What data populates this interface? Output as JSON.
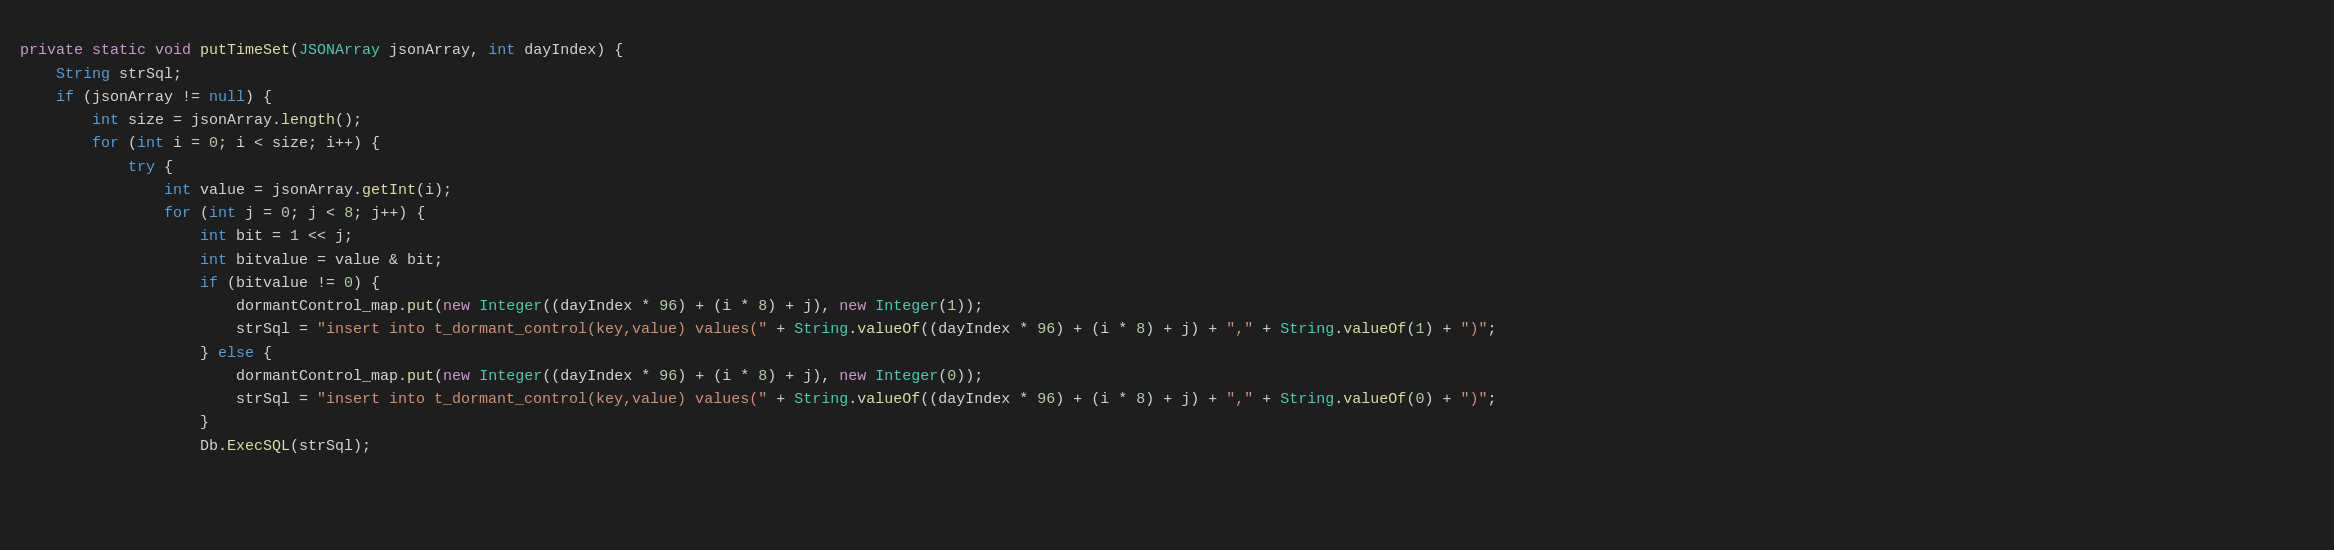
{
  "code": {
    "lines": [
      {
        "id": 1,
        "tokens": [
          {
            "text": "private ",
            "cls": "kw-purple"
          },
          {
            "text": "static ",
            "cls": "kw-purple"
          },
          {
            "text": "void ",
            "cls": "kw-purple"
          },
          {
            "text": "putTimeSet",
            "cls": "fn-yellow"
          },
          {
            "text": "(",
            "cls": "plain"
          },
          {
            "text": "JSONArray",
            "cls": "type-teal"
          },
          {
            "text": " jsonArray, ",
            "cls": "plain"
          },
          {
            "text": "int",
            "cls": "kw-blue"
          },
          {
            "text": " dayIndex) ",
            "cls": "plain"
          },
          {
            "text": "{",
            "cls": "plain"
          }
        ]
      },
      {
        "id": 2,
        "tokens": [
          {
            "text": "    ",
            "cls": "plain"
          },
          {
            "text": "String",
            "cls": "kw-blue"
          },
          {
            "text": " strSql;",
            "cls": "plain"
          }
        ]
      },
      {
        "id": 3,
        "tokens": [
          {
            "text": "    ",
            "cls": "plain"
          },
          {
            "text": "if",
            "cls": "kw-blue"
          },
          {
            "text": " (jsonArray != ",
            "cls": "plain"
          },
          {
            "text": "null",
            "cls": "null-blue"
          },
          {
            "text": ") {",
            "cls": "plain"
          }
        ]
      },
      {
        "id": 4,
        "tokens": [
          {
            "text": "        ",
            "cls": "plain"
          },
          {
            "text": "int",
            "cls": "kw-blue"
          },
          {
            "text": " size = jsonArray.",
            "cls": "plain"
          },
          {
            "text": "length",
            "cls": "fn-yellow"
          },
          {
            "text": "();",
            "cls": "plain"
          }
        ]
      },
      {
        "id": 5,
        "tokens": [
          {
            "text": "        ",
            "cls": "plain"
          },
          {
            "text": "for",
            "cls": "kw-blue"
          },
          {
            "text": " (",
            "cls": "plain"
          },
          {
            "text": "int",
            "cls": "kw-blue"
          },
          {
            "text": " i = ",
            "cls": "plain"
          },
          {
            "text": "0",
            "cls": "num-green"
          },
          {
            "text": "; i < size; i++) {",
            "cls": "plain"
          }
        ]
      },
      {
        "id": 6,
        "tokens": [
          {
            "text": "            ",
            "cls": "plain"
          },
          {
            "text": "try",
            "cls": "kw-blue"
          },
          {
            "text": " {",
            "cls": "plain"
          }
        ]
      },
      {
        "id": 7,
        "tokens": [
          {
            "text": "                ",
            "cls": "plain"
          },
          {
            "text": "int",
            "cls": "kw-blue"
          },
          {
            "text": " value = jsonArray.",
            "cls": "plain"
          },
          {
            "text": "getInt",
            "cls": "fn-yellow"
          },
          {
            "text": "(i);",
            "cls": "plain"
          }
        ]
      },
      {
        "id": 8,
        "tokens": [
          {
            "text": "                ",
            "cls": "plain"
          },
          {
            "text": "for",
            "cls": "kw-blue"
          },
          {
            "text": " (",
            "cls": "plain"
          },
          {
            "text": "int",
            "cls": "kw-blue"
          },
          {
            "text": " j = ",
            "cls": "plain"
          },
          {
            "text": "0",
            "cls": "num-green"
          },
          {
            "text": "; j < ",
            "cls": "plain"
          },
          {
            "text": "8",
            "cls": "num-green"
          },
          {
            "text": "; j++) {",
            "cls": "plain"
          }
        ]
      },
      {
        "id": 9,
        "tokens": [
          {
            "text": "                    ",
            "cls": "plain"
          },
          {
            "text": "int",
            "cls": "kw-blue"
          },
          {
            "text": " bit = ",
            "cls": "plain"
          },
          {
            "text": "1",
            "cls": "num-green"
          },
          {
            "text": " << j;",
            "cls": "plain"
          }
        ]
      },
      {
        "id": 10,
        "tokens": [
          {
            "text": "                    ",
            "cls": "plain"
          },
          {
            "text": "int",
            "cls": "kw-blue"
          },
          {
            "text": " bitvalue = value & bit;",
            "cls": "plain"
          }
        ]
      },
      {
        "id": 11,
        "tokens": [
          {
            "text": "                    ",
            "cls": "plain"
          },
          {
            "text": "if",
            "cls": "kw-blue"
          },
          {
            "text": " (bitvalue != ",
            "cls": "plain"
          },
          {
            "text": "0",
            "cls": "num-green"
          },
          {
            "text": ") {",
            "cls": "plain"
          }
        ]
      },
      {
        "id": 12,
        "tokens": [
          {
            "text": "                        dormantControl_map.",
            "cls": "plain"
          },
          {
            "text": "put",
            "cls": "fn-yellow"
          },
          {
            "text": "(",
            "cls": "plain"
          },
          {
            "text": "new",
            "cls": "kw-purple"
          },
          {
            "text": " ",
            "cls": "plain"
          },
          {
            "text": "Integer",
            "cls": "type-teal"
          },
          {
            "text": "((dayIndex * ",
            "cls": "plain"
          },
          {
            "text": "96",
            "cls": "num-green"
          },
          {
            "text": ") + (i * ",
            "cls": "plain"
          },
          {
            "text": "8",
            "cls": "num-green"
          },
          {
            "text": ") + j), ",
            "cls": "plain"
          },
          {
            "text": "new",
            "cls": "kw-purple"
          },
          {
            "text": " ",
            "cls": "plain"
          },
          {
            "text": "Integer",
            "cls": "type-teal"
          },
          {
            "text": "(",
            "cls": "plain"
          },
          {
            "text": "1",
            "cls": "num-green"
          },
          {
            "text": "));",
            "cls": "plain"
          }
        ]
      },
      {
        "id": 13,
        "tokens": [
          {
            "text": "                        strSql = ",
            "cls": "plain"
          },
          {
            "text": "\"insert into t_dormant_control(key,value) values(\"",
            "cls": "str-orange"
          },
          {
            "text": " + ",
            "cls": "plain"
          },
          {
            "text": "String",
            "cls": "type-teal"
          },
          {
            "text": ".",
            "cls": "plain"
          },
          {
            "text": "valueOf",
            "cls": "fn-yellow"
          },
          {
            "text": "((dayIndex * ",
            "cls": "plain"
          },
          {
            "text": "96",
            "cls": "num-green"
          },
          {
            "text": ") + (i * ",
            "cls": "plain"
          },
          {
            "text": "8",
            "cls": "num-green"
          },
          {
            "text": ") + j) + ",
            "cls": "plain"
          },
          {
            "text": "\",\"",
            "cls": "str-orange"
          },
          {
            "text": " + ",
            "cls": "plain"
          },
          {
            "text": "String",
            "cls": "type-teal"
          },
          {
            "text": ".",
            "cls": "plain"
          },
          {
            "text": "valueOf",
            "cls": "fn-yellow"
          },
          {
            "text": "(",
            "cls": "plain"
          },
          {
            "text": "1",
            "cls": "num-green"
          },
          {
            "text": ") + ",
            "cls": "plain"
          },
          {
            "text": "\")\"",
            "cls": "str-orange"
          },
          {
            "text": ";",
            "cls": "plain"
          }
        ]
      },
      {
        "id": 14,
        "tokens": [
          {
            "text": "                    ",
            "cls": "plain"
          },
          {
            "text": "} ",
            "cls": "plain"
          },
          {
            "text": "else",
            "cls": "kw-blue"
          },
          {
            "text": " {",
            "cls": "plain"
          }
        ]
      },
      {
        "id": 15,
        "tokens": [
          {
            "text": "                        dormantControl_map.",
            "cls": "plain"
          },
          {
            "text": "put",
            "cls": "fn-yellow"
          },
          {
            "text": "(",
            "cls": "plain"
          },
          {
            "text": "new",
            "cls": "kw-purple"
          },
          {
            "text": " ",
            "cls": "plain"
          },
          {
            "text": "Integer",
            "cls": "type-teal"
          },
          {
            "text": "((dayIndex * ",
            "cls": "plain"
          },
          {
            "text": "96",
            "cls": "num-green"
          },
          {
            "text": ") + (i * ",
            "cls": "plain"
          },
          {
            "text": "8",
            "cls": "num-green"
          },
          {
            "text": ") + j), ",
            "cls": "plain"
          },
          {
            "text": "new",
            "cls": "kw-purple"
          },
          {
            "text": " ",
            "cls": "plain"
          },
          {
            "text": "Integer",
            "cls": "type-teal"
          },
          {
            "text": "(",
            "cls": "plain"
          },
          {
            "text": "0",
            "cls": "num-green"
          },
          {
            "text": "));",
            "cls": "plain"
          }
        ]
      },
      {
        "id": 16,
        "tokens": [
          {
            "text": "                        strSql = ",
            "cls": "plain"
          },
          {
            "text": "\"insert into t_dormant_control(key,value) values(\"",
            "cls": "str-orange"
          },
          {
            "text": " + ",
            "cls": "plain"
          },
          {
            "text": "String",
            "cls": "type-teal"
          },
          {
            "text": ".",
            "cls": "plain"
          },
          {
            "text": "valueOf",
            "cls": "fn-yellow"
          },
          {
            "text": "((dayIndex * ",
            "cls": "plain"
          },
          {
            "text": "96",
            "cls": "num-green"
          },
          {
            "text": ") + (i * ",
            "cls": "plain"
          },
          {
            "text": "8",
            "cls": "num-green"
          },
          {
            "text": ") + j) + ",
            "cls": "plain"
          },
          {
            "text": "\",\"",
            "cls": "str-orange"
          },
          {
            "text": " + ",
            "cls": "plain"
          },
          {
            "text": "String",
            "cls": "type-teal"
          },
          {
            "text": ".",
            "cls": "plain"
          },
          {
            "text": "valueOf",
            "cls": "fn-yellow"
          },
          {
            "text": "(",
            "cls": "plain"
          },
          {
            "text": "0",
            "cls": "num-green"
          },
          {
            "text": ") + ",
            "cls": "plain"
          },
          {
            "text": "\")\"",
            "cls": "str-orange"
          },
          {
            "text": ";",
            "cls": "plain"
          }
        ]
      },
      {
        "id": 17,
        "tokens": [
          {
            "text": "                    }",
            "cls": "plain"
          }
        ]
      },
      {
        "id": 18,
        "tokens": [
          {
            "text": "                    Db.",
            "cls": "plain"
          },
          {
            "text": "ExecSQL",
            "cls": "fn-yellow"
          },
          {
            "text": "(strSql);",
            "cls": "plain"
          }
        ]
      }
    ]
  }
}
